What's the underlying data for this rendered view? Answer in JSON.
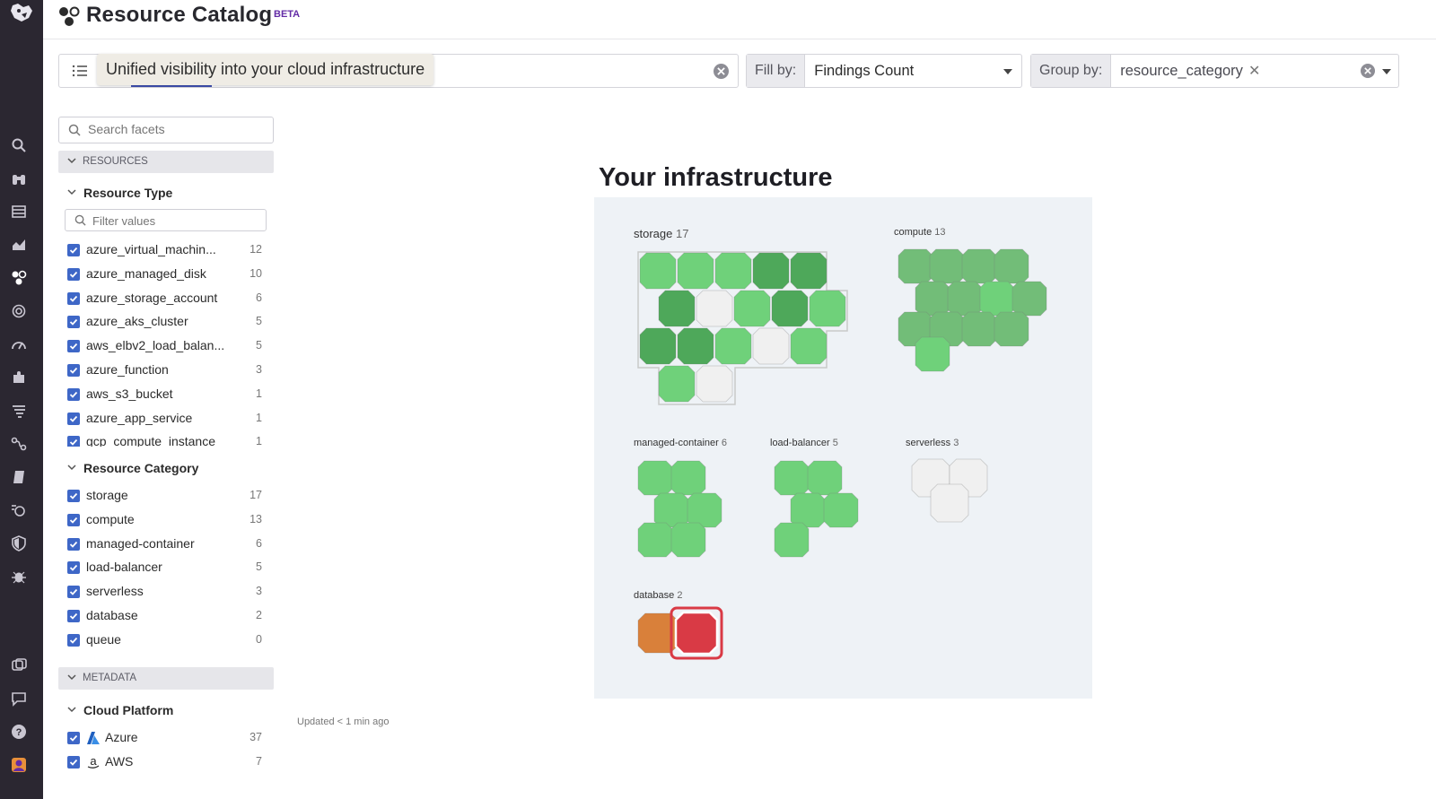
{
  "header": {
    "title": "Resource Catalog",
    "badge": "BETA"
  },
  "query": {
    "tooltip": "Unified visibility into your cloud infrastructure"
  },
  "fill_by": {
    "label": "Fill by:",
    "value": "Findings Count"
  },
  "group_by": {
    "label": "Group by:",
    "chip": "resource_category"
  },
  "facets": {
    "search_placeholder": "Search facets",
    "resources_section": "RESOURCES",
    "resource_type": {
      "title": "Resource Type",
      "filter_placeholder": "Filter values",
      "items": [
        {
          "label": "azure_virtual_machin...",
          "count": "12"
        },
        {
          "label": "azure_managed_disk",
          "count": "10"
        },
        {
          "label": "azure_storage_account",
          "count": "6"
        },
        {
          "label": "azure_aks_cluster",
          "count": "5"
        },
        {
          "label": "aws_elbv2_load_balan...",
          "count": "5"
        },
        {
          "label": "azure_function",
          "count": "3"
        },
        {
          "label": "aws_s3_bucket",
          "count": "1"
        },
        {
          "label": "azure_app_service",
          "count": "1"
        },
        {
          "label": "gcp_compute_instance",
          "count": "1"
        }
      ]
    },
    "resource_category": {
      "title": "Resource Category",
      "items": [
        {
          "label": "storage",
          "count": "17"
        },
        {
          "label": "compute",
          "count": "13"
        },
        {
          "label": "managed-container",
          "count": "6"
        },
        {
          "label": "load-balancer",
          "count": "5"
        },
        {
          "label": "serverless",
          "count": "3"
        },
        {
          "label": "database",
          "count": "2"
        },
        {
          "label": "queue",
          "count": "0"
        }
      ]
    },
    "metadata_section": "METADATA",
    "cloud_platform": {
      "title": "Cloud Platform",
      "items": [
        {
          "label": "Azure",
          "count": "37"
        },
        {
          "label": "AWS",
          "count": "7"
        }
      ]
    }
  },
  "main": {
    "title": "Your infrastructure",
    "updated": "Updated < 1 min ago",
    "groups": [
      {
        "name": "storage",
        "count": "17"
      },
      {
        "name": "compute",
        "count": "13"
      },
      {
        "name": "managed-container",
        "count": "6"
      },
      {
        "name": "load-balancer",
        "count": "5"
      },
      {
        "name": "serverless",
        "count": "3"
      },
      {
        "name": "database",
        "count": "2"
      }
    ],
    "colors": {
      "green_light": "#6fd17a",
      "green_mid": "#5ec06a",
      "green_dark": "#4ea85a",
      "green_gray": "#72bd78",
      "empty": "#f0f0f0",
      "orange": "#d9803a",
      "red": "#d93a45"
    }
  }
}
